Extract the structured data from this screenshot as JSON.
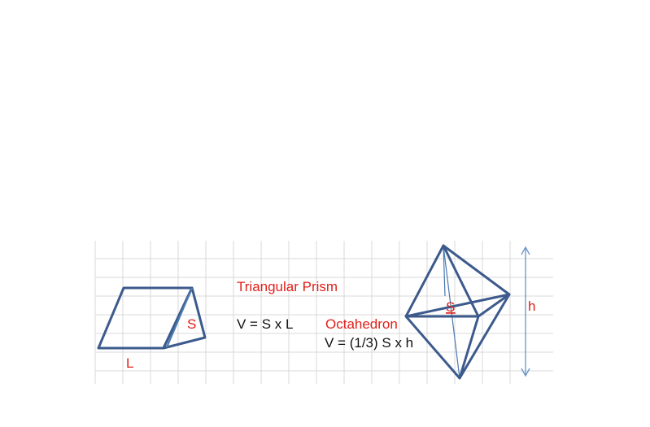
{
  "prism": {
    "title": "Triangular Prism",
    "formula": "V = S x L",
    "label_s": "S",
    "label_l": "L"
  },
  "octahedron": {
    "title": "Octahedron",
    "formula": "V = (1/3) S x h",
    "label_s": "S",
    "label_h": "h"
  },
  "colors": {
    "label_red": "#e0201a",
    "edge_blue": "#3c5a8c",
    "grid_gray": "#d9d9d9"
  }
}
